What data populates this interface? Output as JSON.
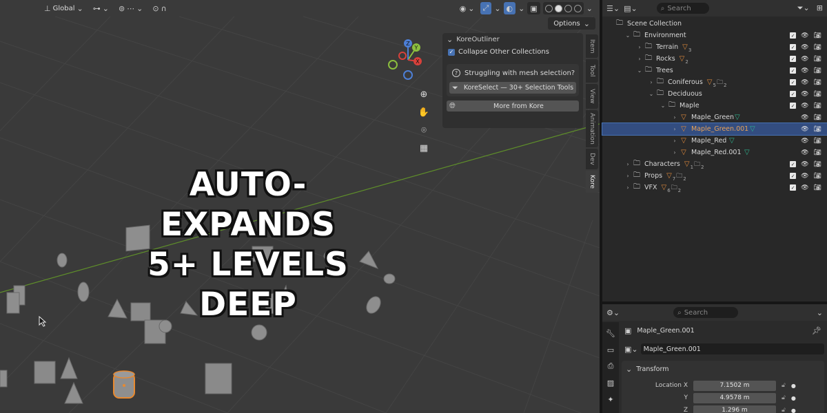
{
  "viewport": {
    "header": {
      "orientation": "Global",
      "options_label": "Options"
    },
    "npanel": {
      "title": "KoreOutliner",
      "collapse_label": "Collapse Other Collections",
      "question": "Struggling with mesh selection?",
      "promo_button": "KoreSelect — 30+ Selection Tools",
      "more_button": "More from Kore"
    },
    "tabs": [
      "Item",
      "Tool",
      "View",
      "Animation",
      "Dev",
      "Kore"
    ],
    "gizmo": {
      "x": "X",
      "y": "Y",
      "z": "Z"
    },
    "overlay": {
      "line1": "AUTO-EXPANDS",
      "line2": "5+ LEVELS DEEP"
    }
  },
  "outliner": {
    "search_placeholder": "Search",
    "rows": [
      {
        "name": "Scene Collection",
        "indent": 0,
        "arrow": "",
        "type": "scene"
      },
      {
        "name": "Environment",
        "indent": 1,
        "arrow": "open",
        "type": "coll"
      },
      {
        "name": "Terrain",
        "indent": 2,
        "arrow": "closed",
        "type": "coll",
        "tri": "3"
      },
      {
        "name": "Rocks",
        "indent": 2,
        "arrow": "closed",
        "type": "coll",
        "tri": "2"
      },
      {
        "name": "Trees",
        "indent": 2,
        "arrow": "open",
        "type": "coll"
      },
      {
        "name": "Coniferous",
        "indent": 3,
        "arrow": "closed",
        "type": "coll",
        "tri": "5",
        "coll": "2"
      },
      {
        "name": "Deciduous",
        "indent": 3,
        "arrow": "open",
        "type": "coll"
      },
      {
        "name": "Maple",
        "indent": 4,
        "arrow": "open",
        "type": "coll"
      },
      {
        "name": "Maple_Green",
        "indent": 5,
        "arrow": "closed",
        "type": "obj",
        "mesh": true
      },
      {
        "name": "Maple_Green.001",
        "indent": 5,
        "arrow": "closed",
        "type": "obj",
        "mesh": true,
        "selected": true
      },
      {
        "name": "Maple_Red",
        "indent": 5,
        "arrow": "closed",
        "type": "obj",
        "mesh": true
      },
      {
        "name": "Maple_Red.001",
        "indent": 5,
        "arrow": "closed",
        "type": "obj",
        "mesh": true
      },
      {
        "name": "Characters",
        "indent": 1,
        "arrow": "closed",
        "type": "coll",
        "tri": "1",
        "coll": "2"
      },
      {
        "name": "Props",
        "indent": 1,
        "arrow": "closed",
        "type": "coll",
        "tri": "7",
        "coll": "2"
      },
      {
        "name": "VFX",
        "indent": 1,
        "arrow": "closed",
        "type": "coll",
        "tri": "6",
        "coll": "2"
      }
    ]
  },
  "properties": {
    "search_placeholder": "Search",
    "object_name": "Maple_Green.001",
    "field_value": "Maple_Green.001",
    "transform_title": "Transform",
    "location_label": "Location X",
    "y_label": "Y",
    "z_label": "Z",
    "loc_x": "7.1502 m",
    "loc_y": "4.9578 m",
    "loc_z": "1.296 m"
  },
  "colors": {
    "accent": "#4772b3",
    "selection": "#334d80",
    "object_orange": "#e08a3b",
    "mesh_green": "#2fb58f"
  }
}
